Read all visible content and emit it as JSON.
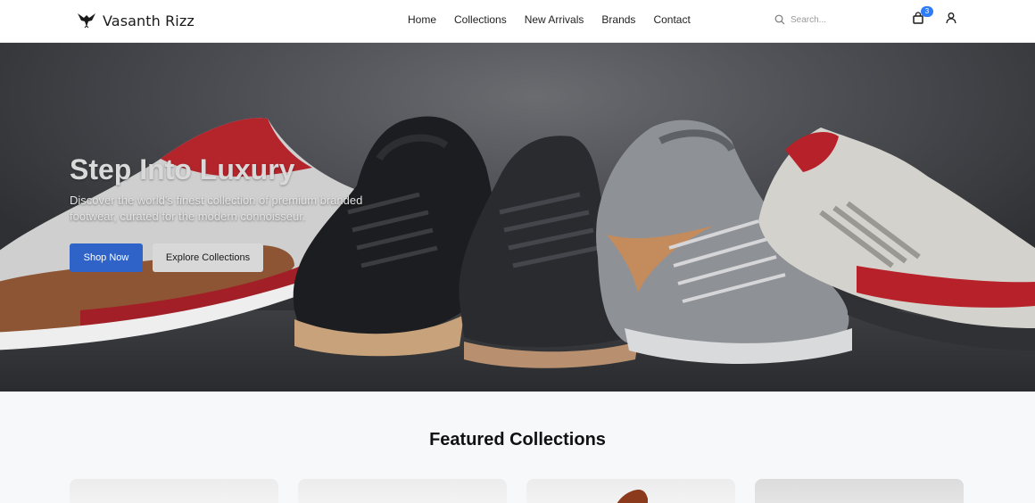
{
  "header": {
    "brand_name": "Vasanth Rizz",
    "nav": [
      "Home",
      "Collections",
      "New Arrivals",
      "Brands",
      "Contact"
    ],
    "search_placeholder": "Search...",
    "cart_count": "3"
  },
  "hero": {
    "title": "Step Into Luxury",
    "subtitle": "Discover the world's finest collection of premium branded footwear, curated for the modern connoisseur.",
    "primary_button": "Shop Now",
    "secondary_button": "Explore Collections"
  },
  "featured": {
    "title": "Featured Collections"
  },
  "colors": {
    "accent": "#2f63c7",
    "badge": "#2e7cf6"
  }
}
